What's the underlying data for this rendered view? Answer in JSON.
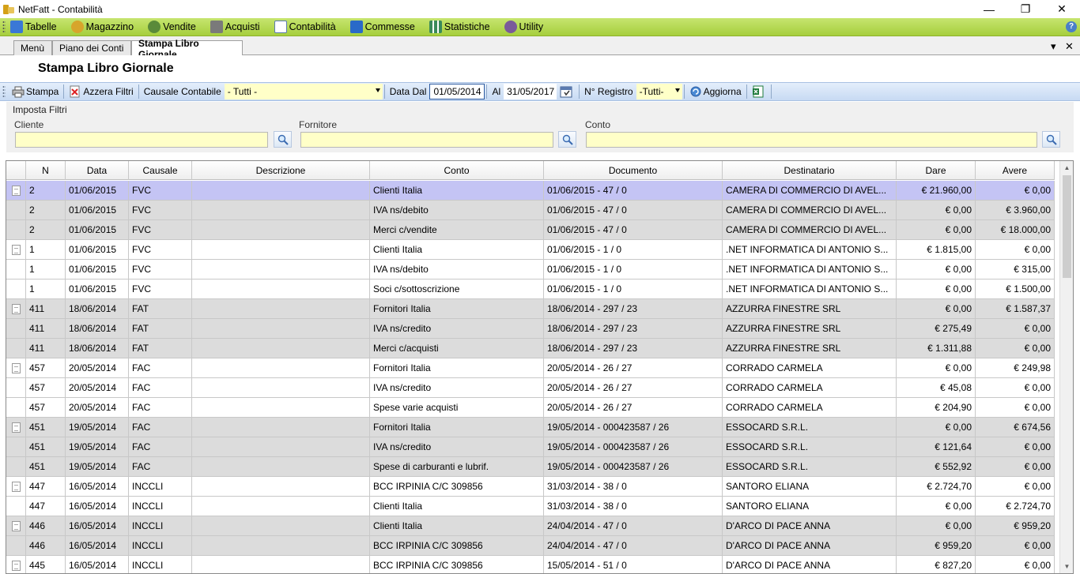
{
  "window": {
    "title": "NetFatt - Contabilità",
    "minimize": "—",
    "restore": "❐",
    "close": "✕"
  },
  "menubar": {
    "items": [
      {
        "label": "Tabelle",
        "icon": "table-icon",
        "color": "#3a78d6"
      },
      {
        "label": "Magazzino",
        "icon": "boxes-icon",
        "color": "#d7a52b"
      },
      {
        "label": "Vendite",
        "icon": "people-icon",
        "color": "#5a8a3a"
      },
      {
        "label": "Acquisti",
        "icon": "cart-icon",
        "color": "#7a7a7a"
      },
      {
        "label": "Contabilità",
        "icon": "window-icon",
        "color": "#5a7ab0"
      },
      {
        "label": "Commesse",
        "icon": "box-icon",
        "color": "#2a6ac8"
      },
      {
        "label": "Statistiche",
        "icon": "chart-icon",
        "color": "#3a8a5a"
      },
      {
        "label": "Utility",
        "icon": "tools-icon",
        "color": "#7a5a9a"
      }
    ],
    "help": "?"
  },
  "tabs": [
    {
      "label": "Menù"
    },
    {
      "label": "Piano dei Conti"
    },
    {
      "label": "Stampa Libro Giornale"
    }
  ],
  "tab_controls": {
    "dropdown": "▾",
    "close": "✕"
  },
  "page_title": "Stampa Libro Giornale",
  "toolbar": {
    "stampa": "Stampa",
    "azzera": "Azzera Filtri",
    "causale_label": "Causale Contabile",
    "causale_value": "- Tutti -",
    "data_dal_label": "Data Dal",
    "data_dal_value": "01/05/2014",
    "al_label": "Al",
    "al_value": "31/05/2017",
    "registro_label": "N° Registro",
    "registro_value": "-Tutti-",
    "aggiorna": "Aggiorna"
  },
  "filters": {
    "title": "Imposta Filtri",
    "cliente": "Cliente",
    "fornitore": "Fornitore",
    "conto": "Conto"
  },
  "grid": {
    "columns": [
      "N",
      "Data",
      "Causale",
      "Descrizione",
      "Conto",
      "Documento",
      "Destinatario",
      "Dare",
      "Avere"
    ],
    "rows": [
      {
        "icon": true,
        "style": "sel",
        "n": "2",
        "data": "01/06/2015",
        "causale": "FVC",
        "descrizione": "",
        "conto": "Clienti Italia",
        "documento": "01/06/2015 - 47 / 0",
        "destinatario": "CAMERA DI COMMERCIO DI AVEL...",
        "dare": "€ 21.960,00",
        "avere": "€ 0,00"
      },
      {
        "icon": false,
        "style": "grey",
        "n": "2",
        "data": "01/06/2015",
        "causale": "FVC",
        "descrizione": "",
        "conto": "IVA ns/debito",
        "documento": "01/06/2015 - 47 / 0",
        "destinatario": "CAMERA DI COMMERCIO DI AVEL...",
        "dare": "€ 0,00",
        "avere": "€ 3.960,00"
      },
      {
        "icon": false,
        "style": "grey",
        "n": "2",
        "data": "01/06/2015",
        "causale": "FVC",
        "descrizione": "",
        "conto": "Merci c/vendite",
        "documento": "01/06/2015 - 47 / 0",
        "destinatario": "CAMERA DI COMMERCIO DI AVEL...",
        "dare": "€ 0,00",
        "avere": "€ 18.000,00"
      },
      {
        "icon": true,
        "style": "white",
        "n": "1",
        "data": "01/06/2015",
        "causale": "FVC",
        "descrizione": "",
        "conto": "Clienti Italia",
        "documento": "01/06/2015 - 1 / 0",
        "destinatario": ".NET INFORMATICA DI ANTONIO S...",
        "dare": "€ 1.815,00",
        "avere": "€ 0,00"
      },
      {
        "icon": false,
        "style": "white",
        "n": "1",
        "data": "01/06/2015",
        "causale": "FVC",
        "descrizione": "",
        "conto": "IVA ns/debito",
        "documento": "01/06/2015 - 1 / 0",
        "destinatario": ".NET INFORMATICA DI ANTONIO S...",
        "dare": "€ 0,00",
        "avere": "€ 315,00"
      },
      {
        "icon": false,
        "style": "white",
        "n": "1",
        "data": "01/06/2015",
        "causale": "FVC",
        "descrizione": "",
        "conto": "Soci c/sottoscrizione",
        "documento": "01/06/2015 - 1 / 0",
        "destinatario": ".NET INFORMATICA DI ANTONIO S...",
        "dare": "€ 0,00",
        "avere": "€ 1.500,00"
      },
      {
        "icon": true,
        "style": "grey",
        "n": "411",
        "data": "18/06/2014",
        "causale": "FAT",
        "descrizione": "",
        "conto": "Fornitori Italia",
        "documento": "18/06/2014 - 297 / 23",
        "destinatario": "AZZURRA FINESTRE SRL",
        "dare": "€ 0,00",
        "avere": "€ 1.587,37"
      },
      {
        "icon": false,
        "style": "grey",
        "n": "411",
        "data": "18/06/2014",
        "causale": "FAT",
        "descrizione": "",
        "conto": "IVA ns/credito",
        "documento": "18/06/2014 - 297 / 23",
        "destinatario": "AZZURRA FINESTRE SRL",
        "dare": "€ 275,49",
        "avere": "€ 0,00"
      },
      {
        "icon": false,
        "style": "grey",
        "n": "411",
        "data": "18/06/2014",
        "causale": "FAT",
        "descrizione": "",
        "conto": "Merci c/acquisti",
        "documento": "18/06/2014 - 297 / 23",
        "destinatario": "AZZURRA FINESTRE SRL",
        "dare": "€ 1.311,88",
        "avere": "€ 0,00"
      },
      {
        "icon": true,
        "style": "white",
        "n": "457",
        "data": "20/05/2014",
        "causale": "FAC",
        "descrizione": "",
        "conto": "Fornitori Italia",
        "documento": "20/05/2014 - 26 / 27",
        "destinatario": "CORRADO CARMELA",
        "dare": "€ 0,00",
        "avere": "€ 249,98"
      },
      {
        "icon": false,
        "style": "white",
        "n": "457",
        "data": "20/05/2014",
        "causale": "FAC",
        "descrizione": "",
        "conto": "IVA ns/credito",
        "documento": "20/05/2014 - 26 / 27",
        "destinatario": "CORRADO CARMELA",
        "dare": "€ 45,08",
        "avere": "€ 0,00"
      },
      {
        "icon": false,
        "style": "white",
        "n": "457",
        "data": "20/05/2014",
        "causale": "FAC",
        "descrizione": "",
        "conto": "Spese varie acquisti",
        "documento": "20/05/2014 - 26 / 27",
        "destinatario": "CORRADO CARMELA",
        "dare": "€ 204,90",
        "avere": "€ 0,00"
      },
      {
        "icon": true,
        "style": "grey",
        "n": "451",
        "data": "19/05/2014",
        "causale": "FAC",
        "descrizione": "",
        "conto": "Fornitori Italia",
        "documento": "19/05/2014 - 000423587 / 26",
        "destinatario": "ESSOCARD S.R.L.",
        "dare": "€ 0,00",
        "avere": "€ 674,56"
      },
      {
        "icon": false,
        "style": "grey",
        "n": "451",
        "data": "19/05/2014",
        "causale": "FAC",
        "descrizione": "",
        "conto": "IVA ns/credito",
        "documento": "19/05/2014 - 000423587 / 26",
        "destinatario": "ESSOCARD S.R.L.",
        "dare": "€ 121,64",
        "avere": "€ 0,00"
      },
      {
        "icon": false,
        "style": "grey",
        "n": "451",
        "data": "19/05/2014",
        "causale": "FAC",
        "descrizione": "",
        "conto": "Spese di carburanti e lubrif.",
        "documento": "19/05/2014 - 000423587 / 26",
        "destinatario": "ESSOCARD S.R.L.",
        "dare": "€ 552,92",
        "avere": "€ 0,00"
      },
      {
        "icon": true,
        "style": "white",
        "n": "447",
        "data": "16/05/2014",
        "causale": "INCCLI",
        "descrizione": "",
        "conto": "BCC IRPINIA C/C 309856",
        "documento": "31/03/2014 - 38 / 0",
        "destinatario": "SANTORO ELIANA",
        "dare": "€ 2.724,70",
        "avere": "€ 0,00"
      },
      {
        "icon": false,
        "style": "white",
        "n": "447",
        "data": "16/05/2014",
        "causale": "INCCLI",
        "descrizione": "",
        "conto": "Clienti Italia",
        "documento": "31/03/2014 - 38 / 0",
        "destinatario": "SANTORO ELIANA",
        "dare": "€ 0,00",
        "avere": "€ 2.724,70"
      },
      {
        "icon": true,
        "style": "grey",
        "n": "446",
        "data": "16/05/2014",
        "causale": "INCCLI",
        "descrizione": "",
        "conto": "Clienti Italia",
        "documento": "24/04/2014 - 47 / 0",
        "destinatario": "D'ARCO DI PACE ANNA",
        "dare": "€ 0,00",
        "avere": "€ 959,20"
      },
      {
        "icon": false,
        "style": "grey",
        "n": "446",
        "data": "16/05/2014",
        "causale": "INCCLI",
        "descrizione": "",
        "conto": "BCC IRPINIA C/C 309856",
        "documento": "24/04/2014 - 47 / 0",
        "destinatario": "D'ARCO DI PACE ANNA",
        "dare": "€ 959,20",
        "avere": "€ 0,00"
      },
      {
        "icon": true,
        "style": "white",
        "n": "445",
        "data": "16/05/2014",
        "causale": "INCCLI",
        "descrizione": "",
        "conto": "BCC IRPINIA C/C 309856",
        "documento": "15/05/2014 - 51 / 0",
        "destinatario": "D'ARCO DI PACE ANNA",
        "dare": "€ 827,20",
        "avere": "€ 0,00"
      }
    ]
  }
}
